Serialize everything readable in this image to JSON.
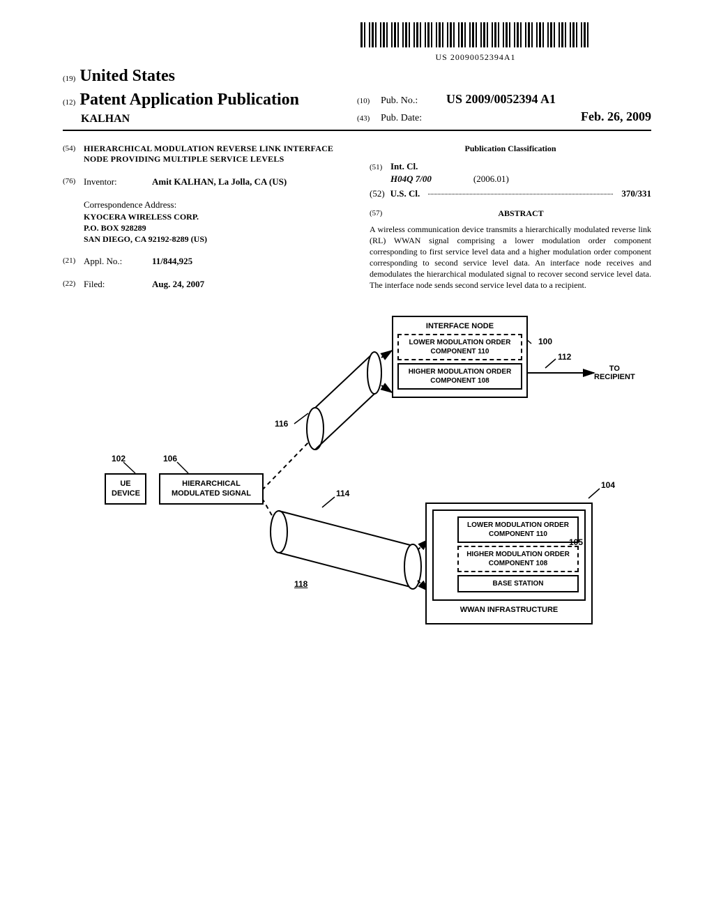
{
  "barcode_text": "US 20090052394A1",
  "header": {
    "country_sup": "(19)",
    "country": "United States",
    "pub_sup": "(12)",
    "pub_type": "Patent Application Publication",
    "applicant": "KALHAN",
    "pubno_sup": "(10)",
    "pubno_label": "Pub. No.:",
    "pubno_value": "US 2009/0052394 A1",
    "pubdate_sup": "(43)",
    "pubdate_label": "Pub. Date:",
    "pubdate_value": "Feb. 26, 2009"
  },
  "left": {
    "title_sup": "(54)",
    "title": "HIERARCHICAL MODULATION REVERSE LINK INTERFACE NODE PROVIDING MULTIPLE SERVICE LEVELS",
    "inventor_sup": "(76)",
    "inventor_label": "Inventor:",
    "inventor_value": "Amit KALHAN, La Jolla, CA (US)",
    "corr_label": "Correspondence Address:",
    "corr_lines": [
      "KYOCERA WIRELESS CORP.",
      "P.O. BOX 928289",
      "SAN DIEGO, CA 92192-8289 (US)"
    ],
    "appl_sup": "(21)",
    "appl_label": "Appl. No.:",
    "appl_value": "11/844,925",
    "filed_sup": "(22)",
    "filed_label": "Filed:",
    "filed_value": "Aug. 24, 2007"
  },
  "right": {
    "class_head": "Publication Classification",
    "intcl_sup": "(51)",
    "intcl_label": "Int. Cl.",
    "intcl_code": "H04Q  7/00",
    "intcl_date": "(2006.01)",
    "uscl_sup": "(52)",
    "uscl_label": "U.S. Cl.",
    "uscl_code": "370/331",
    "abstract_sup": "(57)",
    "abstract_head": "ABSTRACT",
    "abstract_body": "A wireless communication device transmits a hierarchically modulated reverse link (RL) WWAN signal comprising a lower modulation order component corresponding to first service level data and a higher modulation order component corresponding to second service level data. An interface node receives and demodulates the hierarchical modulated signal to recover second service level data. The interface node sends second service level data to a recipient."
  },
  "figure": {
    "interface_node": "INTERFACE NODE",
    "lower_mod": "LOWER MODULATION ORDER COMPONENT",
    "lower_mod_ref": "110",
    "higher_mod": "HIGHER MODULATION ORDER COMPONENT",
    "higher_mod_ref": "108",
    "to_recipient": "TO RECIPIENT",
    "ue_device": "UE DEVICE",
    "hier_signal_top": "HIERARCHICAL",
    "hier_signal_bot": "MODULATED SIGNAL",
    "base_station": "BASE STATION",
    "wwan": "WWAN INFRASTRUCTURE",
    "r100": "100",
    "r112": "112",
    "r116": "116",
    "r102": "102",
    "r106": "106",
    "r114": "114",
    "r104": "104",
    "r105": "105",
    "r118": "118"
  }
}
